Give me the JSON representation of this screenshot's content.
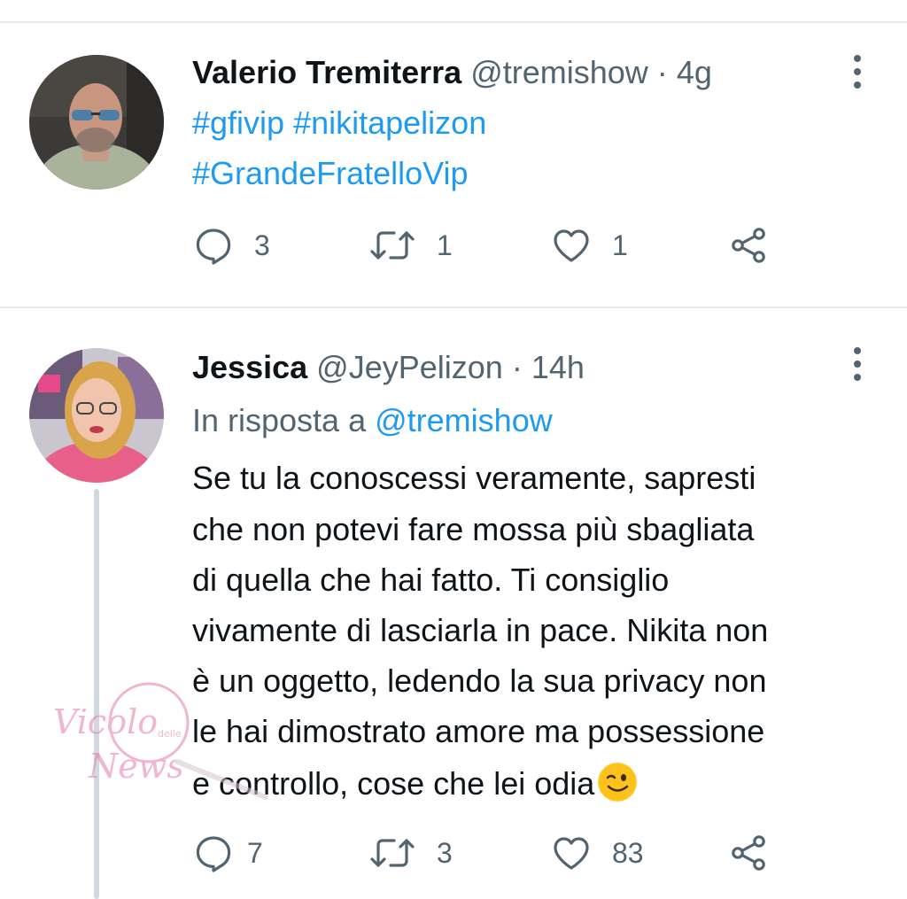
{
  "tweets": [
    {
      "display_name": "Valerio Tremiterra",
      "handle": "@tremishow",
      "separator": "·",
      "time": "4g",
      "lines": [
        "#gfivip #nikitapelizon",
        "#GrandeFratelloVip"
      ],
      "replies": "3",
      "retweets": "1",
      "likes": "1"
    },
    {
      "display_name": "Jessica",
      "handle": "@JeyPelizon",
      "separator": "·",
      "time": "14h",
      "reply_prefix": "In risposta a",
      "reply_to": "@tremishow",
      "lines": [
        "Se tu la conoscessi veramente, sapresti",
        "che non potevi fare mossa più sbagliata",
        "di quella che hai fatto. Ti consiglio",
        "vivamente di lasciarla in pace. Nikita non",
        "è un oggetto, ledendo la sua privacy non",
        "le hai dimostrato amore ma possessione",
        "e controllo, cose che lei odia"
      ],
      "emoji": "winking-face",
      "replies": "7",
      "retweets": "3",
      "likes": "83"
    }
  ],
  "watermark": {
    "line1": "Vicolo",
    "small": "delle",
    "line2": "News"
  },
  "colors": {
    "link": "#1d9bf0",
    "muted": "#536471",
    "text": "#0f1419",
    "divider": "#e7eaec"
  },
  "icons": [
    "reply-icon",
    "retweet-icon",
    "like-icon",
    "share-icon",
    "more-icon"
  ]
}
